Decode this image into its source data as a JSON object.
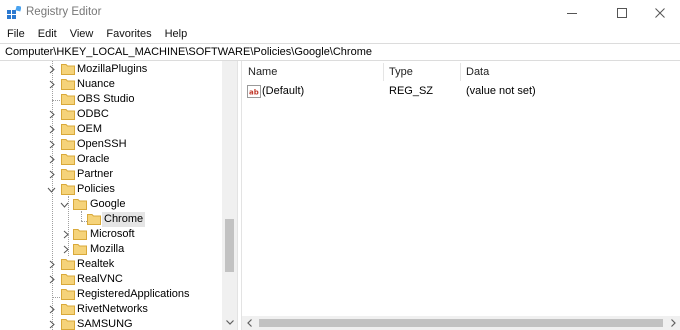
{
  "window": {
    "title": "Registry Editor",
    "controls": {
      "minimize": "minimize",
      "maximize": "maximize",
      "close": "close"
    }
  },
  "menu": [
    "File",
    "Edit",
    "View",
    "Favorites",
    "Help"
  ],
  "address": "Computer\\HKEY_LOCAL_MACHINE\\SOFTWARE\\Policies\\Google\\Chrome",
  "tree": {
    "items": [
      {
        "label": "MozillaPlugins",
        "level": 0,
        "chevron": "right"
      },
      {
        "label": "Nuance",
        "level": 0,
        "chevron": "right"
      },
      {
        "label": "OBS Studio",
        "level": 0,
        "chevron": "none"
      },
      {
        "label": "ODBC",
        "level": 0,
        "chevron": "right"
      },
      {
        "label": "OEM",
        "level": 0,
        "chevron": "right"
      },
      {
        "label": "OpenSSH",
        "level": 0,
        "chevron": "right"
      },
      {
        "label": "Oracle",
        "level": 0,
        "chevron": "right"
      },
      {
        "label": "Partner",
        "level": 0,
        "chevron": "right"
      },
      {
        "label": "Policies",
        "level": 0,
        "chevron": "down"
      },
      {
        "label": "Google",
        "level": 1,
        "chevron": "down"
      },
      {
        "label": "Chrome",
        "level": 2,
        "chevron": "none",
        "selected": true
      },
      {
        "label": "Microsoft",
        "level": 1,
        "chevron": "right"
      },
      {
        "label": "Mozilla",
        "level": 1,
        "chevron": "right"
      },
      {
        "label": "Realtek",
        "level": 0,
        "chevron": "right"
      },
      {
        "label": "RealVNC",
        "level": 0,
        "chevron": "right"
      },
      {
        "label": "RegisteredApplications",
        "level": 0,
        "chevron": "none"
      },
      {
        "label": "RivetNetworks",
        "level": 0,
        "chevron": "right"
      },
      {
        "label": "SAMSUNG",
        "level": 0,
        "chevron": "right"
      }
    ]
  },
  "list": {
    "columns": {
      "name": "Name",
      "type": "Type",
      "data": "Data"
    },
    "rows": [
      {
        "icon": "string-value-icon",
        "name": "(Default)",
        "type": "REG_SZ",
        "data": "(value not set)"
      }
    ]
  },
  "colors": {
    "folder": "#f5d37a",
    "folder_edge": "#d9a93a",
    "selection": "#e5e5e5",
    "scroll_thumb": "#c2c2c2"
  }
}
